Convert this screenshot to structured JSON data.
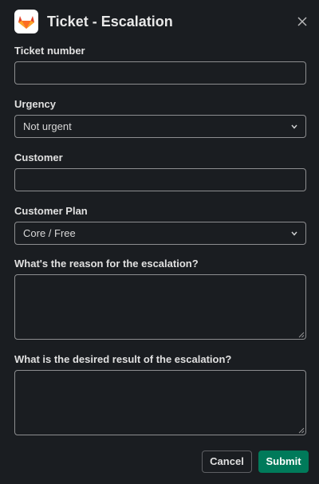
{
  "modal": {
    "title": "Ticket - Escalation",
    "app_icon": "gitlab-tanuki-icon",
    "close_icon": "close-icon"
  },
  "fields": {
    "ticket_number": {
      "label": "Ticket number",
      "value": "",
      "placeholder": ""
    },
    "urgency": {
      "label": "Urgency",
      "selected": "Not urgent"
    },
    "customer": {
      "label": "Customer",
      "value": "",
      "placeholder": ""
    },
    "customer_plan": {
      "label": "Customer Plan",
      "selected": "Core / Free"
    },
    "reason": {
      "label": "What's the reason for the escalation?",
      "value": ""
    },
    "desired_result": {
      "label": "What is the desired result of the escalation?",
      "value": ""
    }
  },
  "actions": {
    "cancel_label": "Cancel",
    "submit_label": "Submit"
  },
  "colors": {
    "background": "#1a1d21",
    "border": "#8d8e90",
    "submit": "#007a5a",
    "logo_orange": "#e24329"
  }
}
